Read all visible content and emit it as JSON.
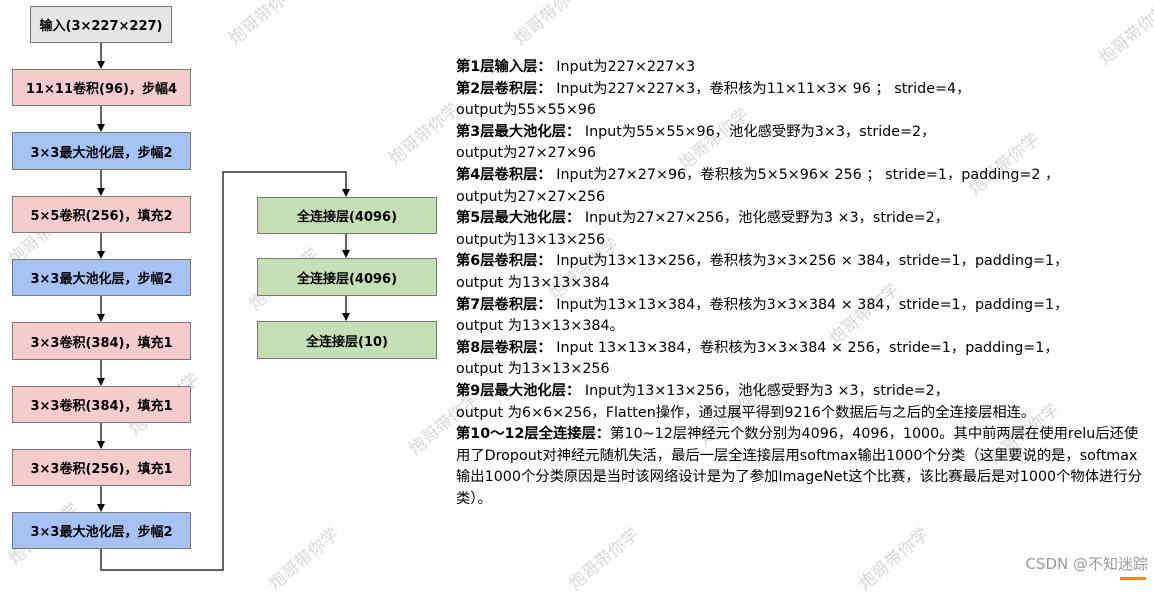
{
  "flow": {
    "left": [
      {
        "label": "输入(3×227×227)",
        "color": "gray"
      },
      {
        "label": "11×11卷积(96)，步幅4",
        "color": "pink"
      },
      {
        "label": "3×3最大池化层，步幅2",
        "color": "blue"
      },
      {
        "label": "5×5卷积(256)，填充2",
        "color": "pink"
      },
      {
        "label": "3×3最大池化层，步幅2",
        "color": "blue"
      },
      {
        "label": "3×3卷积(384)，填充1",
        "color": "pink"
      },
      {
        "label": "3×3卷积(384)，填充1",
        "color": "pink"
      },
      {
        "label": "3×3卷积(256)，填充1",
        "color": "pink"
      },
      {
        "label": "3×3最大池化层，步幅2",
        "color": "blue"
      }
    ],
    "right": [
      {
        "label": "全连接层(4096)",
        "color": "green"
      },
      {
        "label": "全连接层(4096)",
        "color": "green"
      },
      {
        "label": "全连接层(10)",
        "color": "green"
      }
    ]
  },
  "layers": [
    {
      "title": "第1层输入层：",
      "lines": [
        "Input为227×227×3"
      ]
    },
    {
      "title": "第2层卷积层：",
      "lines": [
        "Input为227×227×3，卷积核为11×11×3× 96 ； stride=4，",
        "output为55×55×96"
      ]
    },
    {
      "title": "第3层最大池化层：",
      "lines": [
        "Input为55×55×96，池化感受野为3×3，stride=2，",
        " output为27×27×96"
      ]
    },
    {
      "title": "第4层卷积层：",
      "lines": [
        "Input为27×27×96，卷积核为5×5×96× 256 ； stride=1，padding=2 ，",
        "output为27×27×256"
      ]
    },
    {
      "title": "第5层最大池化层：",
      "lines": [
        "Input为27×27×256，池化感受野为3 ×3，stride=2，",
        "output为13×13×256"
      ]
    },
    {
      "title": "第6层卷积层：",
      "lines": [
        "Input为13×13×256，卷积核为3×3×256 × 384，stride=1，padding=1，",
        "output 为13×13×384"
      ]
    },
    {
      "title": "第7层卷积层：",
      "lines": [
        "Input为13×13×384，卷积核为3×3×384 × 384，stride=1，padding=1，",
        "output 为13×13×384。"
      ]
    },
    {
      "title": "第8层卷积层：",
      "lines": [
        "Input 13×13×384，卷积核为3×3×384 × 256，stride=1，padding=1，",
        "output 为13×13×256"
      ]
    },
    {
      "title": "第9层最大池化层：",
      "lines": [
        "Input为13×13×256，池化感受野为3 ×3，stride=2，",
        "output 为6×6×256，Flatten操作，通过展平得到9216个数据后与之后的全连接层相连。"
      ]
    },
    {
      "title": "第10～12层全连接层：",
      "lines": [
        "第10~12层神经元个数分别为4096，4096，1000。其中前两层在使用relu后还使用了Dropout对神经元随机失活，最后一层全连接层用softmax输出1000个分类（这里要说的是，softmax输出1000个分类原因是当时该网络设计是为了参加ImageNet这个比赛，该比赛最后是对1000个物体进行分类）。"
      ]
    }
  ],
  "watermark": {
    "text": "炮哥带你学"
  },
  "footer": {
    "credit": "CSDN @不知迷踪"
  },
  "colors": {
    "gray": "#e7e6e6",
    "pink": "#f4cccc",
    "blue": "#a4c2f4",
    "green": "#c5e0b4"
  }
}
